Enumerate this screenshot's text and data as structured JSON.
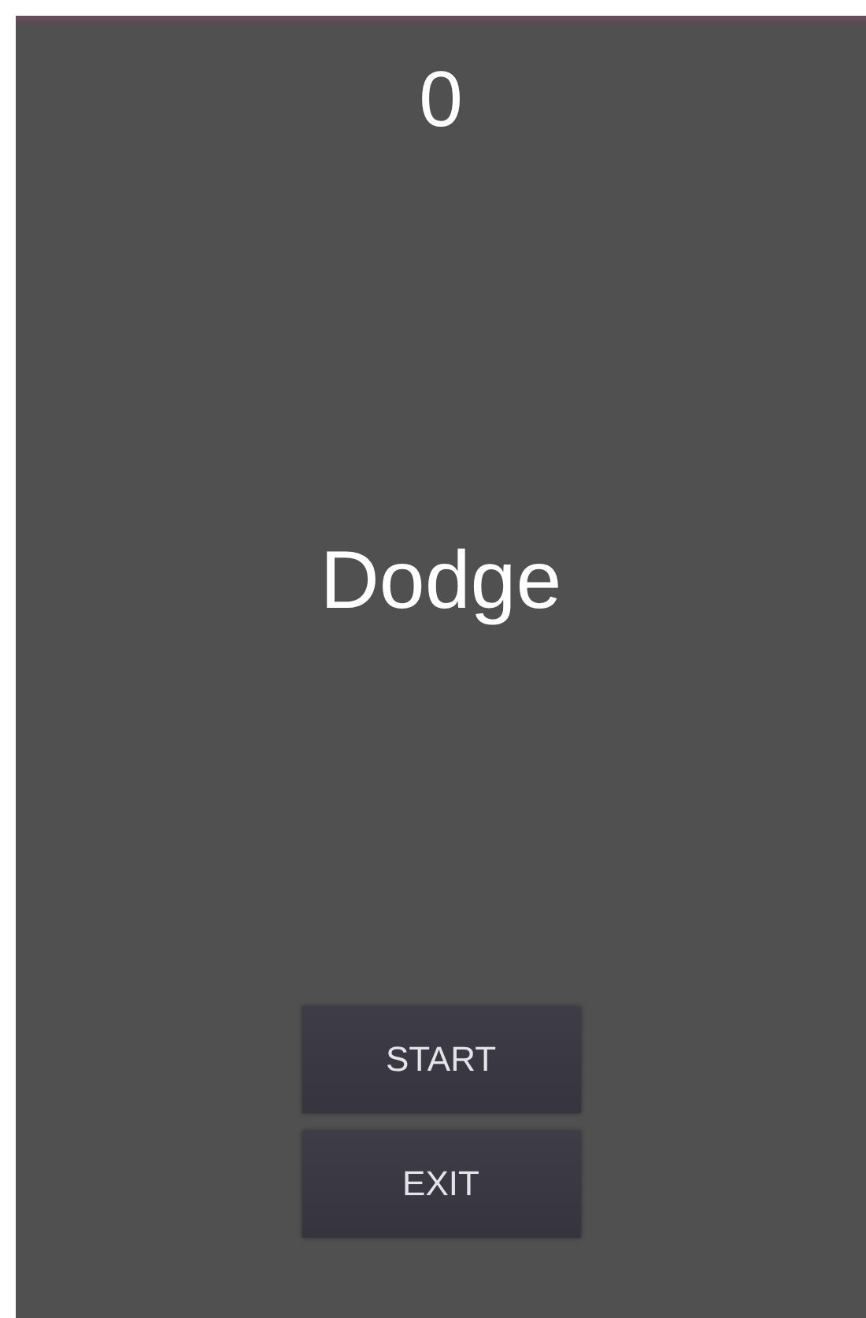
{
  "score": "0",
  "title": "Dodge",
  "buttons": [
    "START",
    "EXIT"
  ]
}
